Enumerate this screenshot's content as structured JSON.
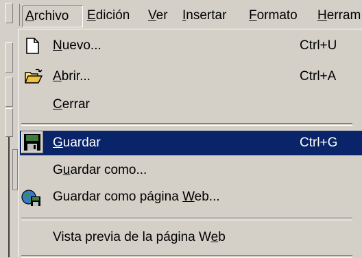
{
  "menubar": {
    "items": [
      {
        "label": "Archivo",
        "mnemonic_index": 0
      },
      {
        "label": "Edición",
        "mnemonic_index": 0
      },
      {
        "label": "Ver",
        "mnemonic_index": 0
      },
      {
        "label": "Insertar",
        "mnemonic_index": 0
      },
      {
        "label": "Formato",
        "mnemonic_index": 0
      },
      {
        "label": "Herram",
        "mnemonic_index": 0
      }
    ],
    "open_menu": "Archivo"
  },
  "file_menu": {
    "items": [
      {
        "label": "Nuevo...",
        "shortcut": "Ctrl+U",
        "icon": "new-document-icon",
        "mnemonic_index": 0
      },
      {
        "label": "Abrir...",
        "shortcut": "Ctrl+A",
        "icon": "open-folder-icon",
        "mnemonic_index": 0
      },
      {
        "label": "Cerrar",
        "shortcut": "",
        "icon": "",
        "mnemonic_index": 0
      },
      {
        "label": "Guardar",
        "shortcut": "Ctrl+G",
        "icon": "save-disk-icon",
        "mnemonic_index": 0,
        "selected": true
      },
      {
        "label": "Guardar como...",
        "shortcut": "",
        "icon": "",
        "mnemonic_index": 1
      },
      {
        "label": "Guardar como página Web...",
        "shortcut": "",
        "icon": "save-as-web-icon",
        "mnemonic_index": 20
      },
      {
        "label": "Vista previa de la página Web",
        "shortcut": "",
        "icon": "",
        "mnemonic_index": 27
      }
    ]
  },
  "colors": {
    "menu_background": "#d4d0c8",
    "selection_background": "#0a246a",
    "selection_text": "#ffffff"
  }
}
